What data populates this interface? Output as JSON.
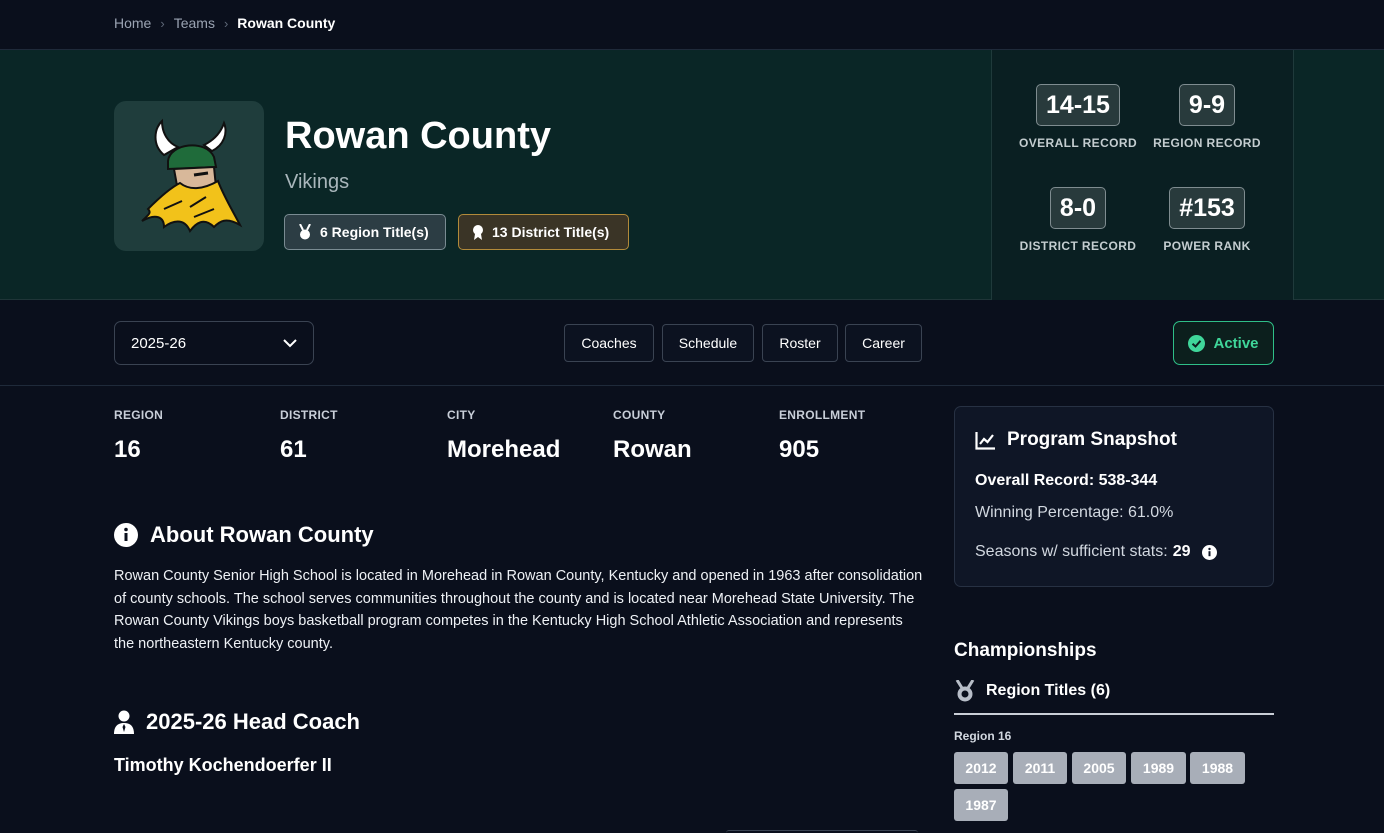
{
  "breadcrumb": {
    "home": "Home",
    "teams": "Teams",
    "current": "Rowan County"
  },
  "team": {
    "name": "Rowan County",
    "mascot": "Vikings",
    "region_titles_badge": "6 Region Title(s)",
    "district_titles_badge": "13 District Title(s)"
  },
  "stats": {
    "overall": {
      "value": "14-15",
      "label": "OVERALL RECORD"
    },
    "region": {
      "value": "9-9",
      "label": "REGION RECORD"
    },
    "district": {
      "value": "8-0",
      "label": "DISTRICT RECORD"
    },
    "power": {
      "value": "#153",
      "label": "POWER RANK"
    }
  },
  "controls": {
    "season": "2025-26",
    "tabs": [
      "Coaches",
      "Schedule",
      "Roster",
      "Career"
    ],
    "status": "Active"
  },
  "info": [
    {
      "key": "REGION",
      "value": "16"
    },
    {
      "key": "DISTRICT",
      "value": "61"
    },
    {
      "key": "CITY",
      "value": "Morehead"
    },
    {
      "key": "COUNTY",
      "value": "Rowan"
    },
    {
      "key": "ENROLLMENT",
      "value": "905"
    }
  ],
  "about": {
    "heading": "About Rowan County",
    "text": "Rowan County Senior High School is located in Morehead in Rowan County, Kentucky and opened in 1963 after consolidation of county schools. The school serves communities throughout the county and is located near Morehead State University. The Rowan County Vikings boys basketball program competes in the Kentucky High School Athletic Association and represents the northeastern Kentucky county."
  },
  "coach": {
    "heading": "2025-26 Head Coach",
    "name": "Timothy Kochendoerfer II"
  },
  "snapshot": {
    "title": "Program Snapshot",
    "overall_record": "Overall Record: 538-344",
    "winning_pct": "Winning Percentage: 61.0%",
    "seasons_label": "Seasons w/ sufficient stats:",
    "seasons_value": "29"
  },
  "championships": {
    "heading": "Championships",
    "tab": "Region Titles (6)",
    "group": "Region 16",
    "years": [
      "2012",
      "2011",
      "2005",
      "1989",
      "1988",
      "1987"
    ]
  },
  "colors": {
    "accent_green": "#3fd69a",
    "hero_bg": "#0a2626",
    "page_bg": "#0a0f1c"
  }
}
